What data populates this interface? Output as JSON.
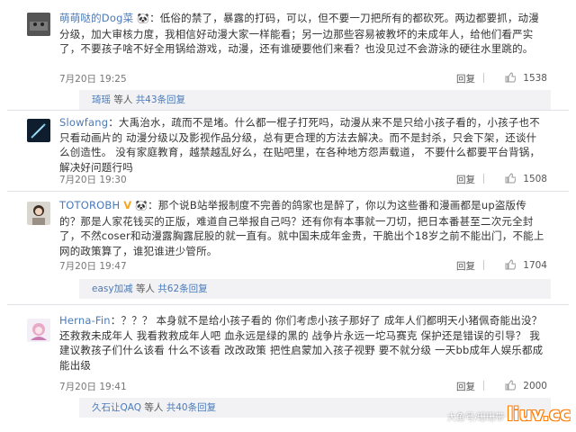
{
  "comments": [
    {
      "username": "萌萌哒的Dog菜",
      "emoji": "🐼",
      "text": "：低俗的禁了，暴露的打码，可以，但不要一刀把所有的都砍死。两边都要抓，动漫分级，加大审核力度，我相信好动漫大家一样能看；另一边那些容易被教坏的未成年人，给他们看严实了，不要孩子啥不好全用锅给游戏，动漫，还有谁硬要他们来看？也没见过不会游泳的硬往水里跳的。",
      "date": "7月20日 19:25",
      "reply_label": "回复",
      "likes": "1538",
      "sub_user": "琦瑶",
      "sub_text": "等人",
      "sub_count": "共43条回复"
    },
    {
      "username": "Slowfang",
      "emoji": "",
      "text": "：大禹治水，疏而不是堵。什么都一棍子打死吗，动漫从来不是只给小孩子看的，小孩子也不只看动画片的 动漫分级以及影视作品分级，总有更合理的方法去解决。而不是封杀，只会下架，还谈什么创造性。 没有家庭教育，越禁越乱好么，在贴吧里，在各种地方怨声载道， 不要什么都要平台背锅，解决好问题行吗",
      "date": "7月20日 19:30",
      "reply_label": "回复",
      "likes": "1508"
    },
    {
      "username": "TOTOROBH",
      "emoji": "🐼",
      "text": "：那个说B站举报制度不完善的鸽家也是醉了，你以为这些番和漫画都是up盗版传的？那是人家花钱买的正版，难道自己举报自己吗？还有你有本事就一刀切，把日本番甚至二次元全封了，不然coser和动漫露胸露屁股的就一直有。就中国未成年金贵，干脆出个18岁之前不能出门，不能上网的政策算了，谁犯谁进少管所。",
      "date": "7月20日 19:47",
      "reply_label": "回复",
      "likes": "1704",
      "sub_user": "easy加减",
      "sub_text": "等人",
      "sub_count": "共62条回复"
    },
    {
      "username": "Herna-Fin",
      "emoji": "",
      "text": "：？？？ 本身就不是给小孩子看的 你们考虑小孩子那好了 成年人们都明天小猪佩奇能出没？还救救未成年人 我看救救成年人吧 血永远是绿的黑的 战争片永远一坨马赛克 保护还是错误的引导？ 我建议教孩子们什么该看 什么不该看 改改政策 把性启蒙加入孩子视野 要不就分级 一天bb成年人娱乐都成能出级",
      "date": "7月20日 19:41",
      "reply_label": "回复",
      "likes": "2000",
      "sub_user": "久石让QAQ",
      "sub_text": "等人",
      "sub_count": "共40条回复"
    }
  ],
  "watermark": {
    "source": "大鱼号/珊珊带",
    "logo": "liuv.cc"
  },
  "colors": {
    "username": "#4a7ab8",
    "subbar_bg": "#f2f2f5",
    "divider": "#dfe3e8"
  }
}
